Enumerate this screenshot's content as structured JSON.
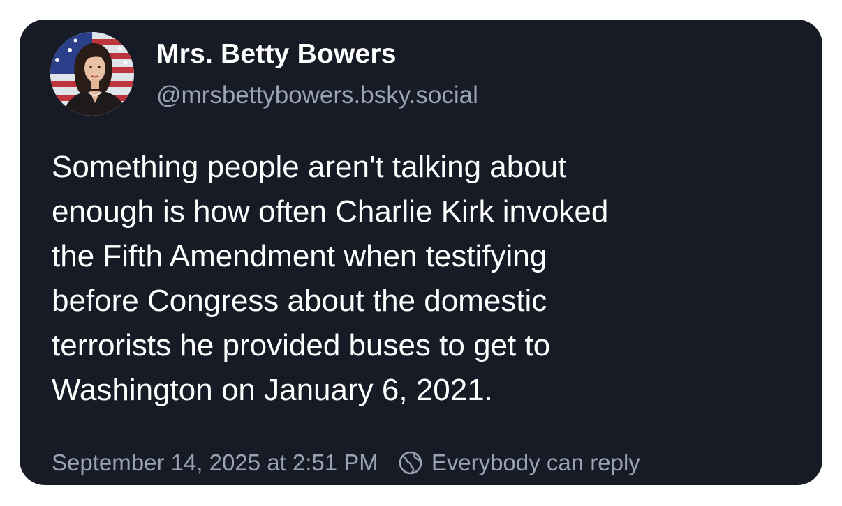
{
  "author": {
    "display_name": "Mrs. Betty Bowers",
    "handle": "@mrsbettybowers.bsky.social",
    "avatar_icon": "profile-photo"
  },
  "post": {
    "lines": [
      "Something people aren't talking about",
      "enough is how often Charlie Kirk invoked",
      "the Fifth Amendment when testifying",
      "before Congress about the domestic",
      "terrorists he provided buses to get to",
      "Washington on January 6, 2021."
    ]
  },
  "footer": {
    "timestamp": "September 14, 2025 at 2:51 PM",
    "reply_setting": "Everybody can reply",
    "reply_icon": "globe-icon"
  },
  "colors": {
    "card_background": "#161b26",
    "text_primary": "#ffffff",
    "text_secondary": "#9aa3b3"
  }
}
